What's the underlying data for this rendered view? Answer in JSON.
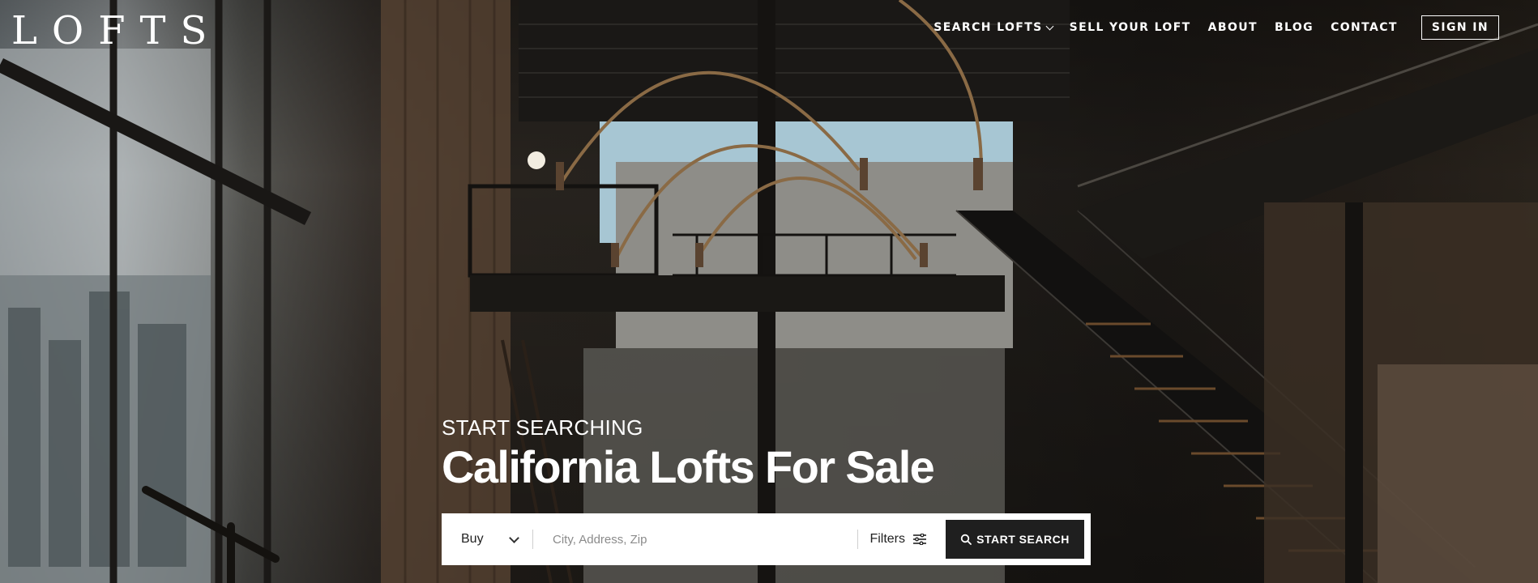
{
  "brand": {
    "logo_text": "LOFTS"
  },
  "nav": {
    "items": [
      {
        "label": "SEARCH LOFTS",
        "has_dropdown": true
      },
      {
        "label": "SELL YOUR LOFT"
      },
      {
        "label": "ABOUT"
      },
      {
        "label": "BLOG"
      },
      {
        "label": "CONTACT"
      }
    ],
    "signin_label": "SIGN IN"
  },
  "hero": {
    "eyebrow": "START SEARCHING",
    "headline": "California Lofts For Sale"
  },
  "search": {
    "mode_value": "Buy",
    "input_placeholder": "City, Address, Zip",
    "input_value": "",
    "filters_label": "Filters",
    "button_label": "START SEARCH"
  },
  "icons": {
    "dropdown": "chevron-down-icon",
    "filters": "sliders-icon",
    "search": "search-icon"
  },
  "colors": {
    "text_on_hero": "#ffffff",
    "search_button_bg": "#1f1f1f",
    "searchbar_bg": "#ffffff"
  }
}
